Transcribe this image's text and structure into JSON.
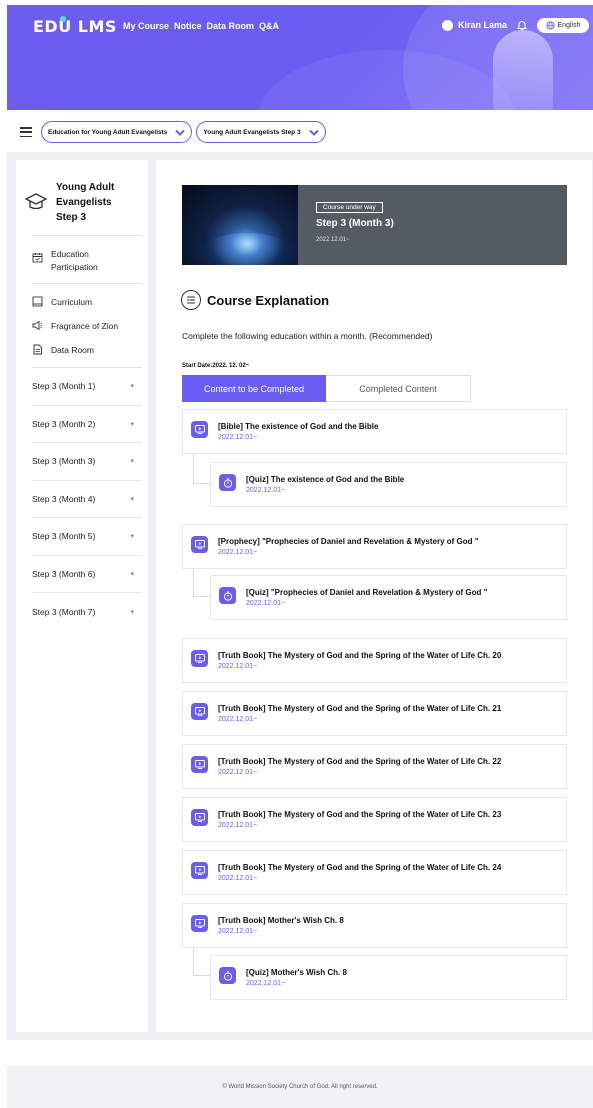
{
  "header": {
    "logo": "EDU LMS",
    "nav": [
      "My Course",
      "Notice",
      "Data Room",
      "Q&A"
    ],
    "user_name": "Kiran Lama",
    "language": "English",
    "colors": {
      "primary": "#6a5df2",
      "accent": "#56e0d8"
    }
  },
  "breadcrumb": {
    "course_select": "Education for Young Adult Evangelists",
    "step_select": "Young Adult Evangelists Step 3"
  },
  "sidebar": {
    "title": "Young Adult Evangelists Step 3",
    "menu": [
      {
        "label": "Education Participation",
        "icon": "calendar-icon"
      },
      {
        "label": "Curriculum",
        "icon": "book-icon"
      },
      {
        "label": "Fragrance of Zion",
        "icon": "megaphone-icon"
      },
      {
        "label": "Data Room",
        "icon": "document-icon"
      }
    ],
    "steps": [
      "Step 3 (Month 1)",
      "Step 3 (Month 2)",
      "Step 3 (Month 3)",
      "Step 3 (Month 4)",
      "Step 3 (Month 5)",
      "Step 3 (Month 6)",
      "Step 3 (Month 7)"
    ]
  },
  "banner": {
    "status": "Course under way",
    "title": "Step 3 (Month 3)",
    "date": "2022.12.01~"
  },
  "explanation": {
    "title": "Course Explanation",
    "description": "Complete the following education within a month. (Recommended)",
    "start_date": "Start Date:2022. 12. 02~"
  },
  "tabs": {
    "active": "Content to be Completed",
    "inactive": "Completed Content"
  },
  "contents": [
    {
      "type": "video",
      "title": "[Bible] The existence of God and the Bible",
      "date": "2022.12.01~"
    },
    {
      "type": "quiz",
      "title": "[Quiz] The existence of God and the Bible",
      "date": "2022.12.01~"
    },
    {
      "type": "video",
      "title": "[Prophecy] \"Prophecies of Daniel and Revelation & Mystery of God \"",
      "date": "2022.12.01~"
    },
    {
      "type": "quiz",
      "title": "[Quiz] \"Prophecies of Daniel and Revelation & Mystery of God \"",
      "date": "2022.12.01~"
    },
    {
      "type": "video",
      "title": "[Truth Book] The Mystery of God and the Spring of the Water of Life Ch. 20",
      "date": "2022.12.01~"
    },
    {
      "type": "video",
      "title": "[Truth Book] The Mystery of God and the Spring of the Water of Life Ch. 21",
      "date": "2022.12.01~"
    },
    {
      "type": "video",
      "title": "[Truth Book] The Mystery of God and the Spring of the Water of Life Ch. 22",
      "date": "2022.12.01~"
    },
    {
      "type": "video",
      "title": "[Truth Book] The Mystery of God and the Spring of the Water of Life Ch. 23",
      "date": "2022.12.01~"
    },
    {
      "type": "video",
      "title": "[Truth Book] The Mystery of God and the Spring of the Water of Life Ch. 24",
      "date": "2022.12.01~"
    },
    {
      "type": "video",
      "title": "[Truth Book] Mother's Wish Ch. 8",
      "date": "2022.12.01~"
    },
    {
      "type": "quiz",
      "title": "[Quiz] Mother's Wish Ch. 8",
      "date": "2022.12.01~"
    }
  ],
  "footer": {
    "copyright": "© World Mission Society Church of God. All right reserved."
  }
}
